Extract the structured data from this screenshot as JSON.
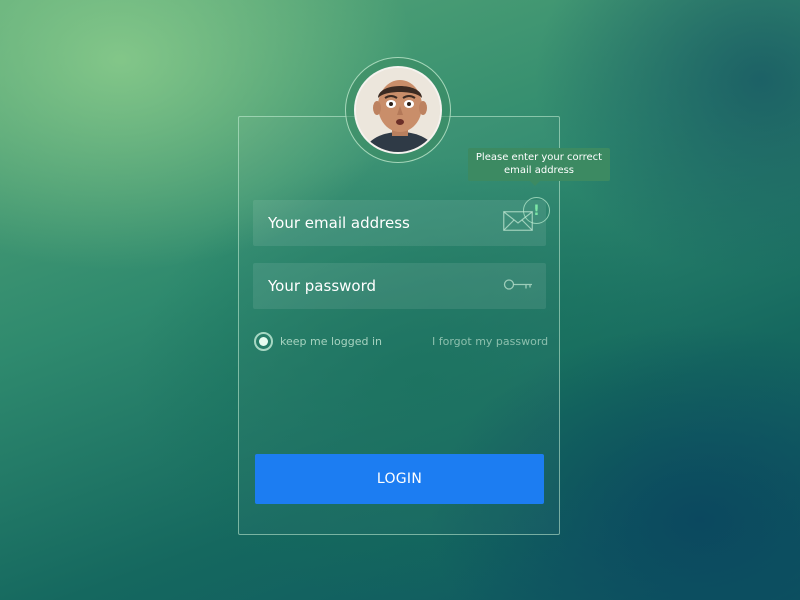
{
  "login_form": {
    "email": {
      "placeholder": "Your email address",
      "value": ""
    },
    "email_error_tooltip": "Please enter your correct email address",
    "password": {
      "placeholder": "Your password",
      "value": ""
    },
    "remember_me": {
      "label": "keep me logged in",
      "checked": true
    },
    "forgot_link": "I forgot my password",
    "login_button": "LOGIN"
  },
  "icons": {
    "email": "envelope-icon",
    "password": "key-icon",
    "alert": "exclamation-icon"
  },
  "colors": {
    "button": "#1c7df2",
    "tooltip": "#3c8a62",
    "alert": "#7ce6a6"
  }
}
